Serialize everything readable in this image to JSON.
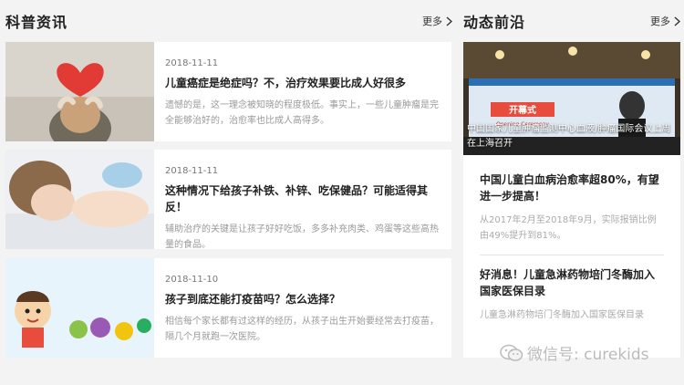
{
  "left_section": {
    "title": "科普资讯",
    "more_label": "更多",
    "articles": [
      {
        "date": "2018-11-11",
        "title": "儿童癌症是绝症吗？不，治疗效果要比成人好很多",
        "excerpt": "遗憾的是，这一理念被知晓的程度极低。事实上，一些儿童肿瘤是完全能够治好的，治愈率也比成人高得多。"
      },
      {
        "date": "2018-11-11",
        "title": "这种情况下给孩子补铁、补锌、吃保健品？可能适得其反！",
        "excerpt": "辅助治疗的关键是让孩子好好吃饭，多多补充肉类、鸡蛋等这些高热量的食品。"
      },
      {
        "date": "2018-11-10",
        "title": "孩子到底还能打疫苗吗？怎么选择？",
        "excerpt": "相信每个家长都有过这样的经历，从孩子出生开始要经常去打疫苗，隔几个月就跑一次医院。"
      }
    ]
  },
  "right_section": {
    "title": "动态前沿",
    "more_label": "更多",
    "feature": {
      "caption": "中国国家儿童肿瘤监测中心血液/肿瘤国际会议上周在上海召开",
      "banner_text": "开幕式",
      "banner_sub": "Opening Ceremony"
    },
    "news": [
      {
        "title": "中国儿童白血病治愈率超80%，有望进一步提高！",
        "excerpt": "从2017年2月至2018年9月，实际报销比例由49%提升到81%。"
      },
      {
        "title": "好消息！儿童急淋药物培门冬酶加入国家医保目录",
        "excerpt": "儿童急淋药物培门冬酶加入国家医保目录"
      }
    ]
  },
  "watermark": {
    "text": "微信号: curekids"
  }
}
